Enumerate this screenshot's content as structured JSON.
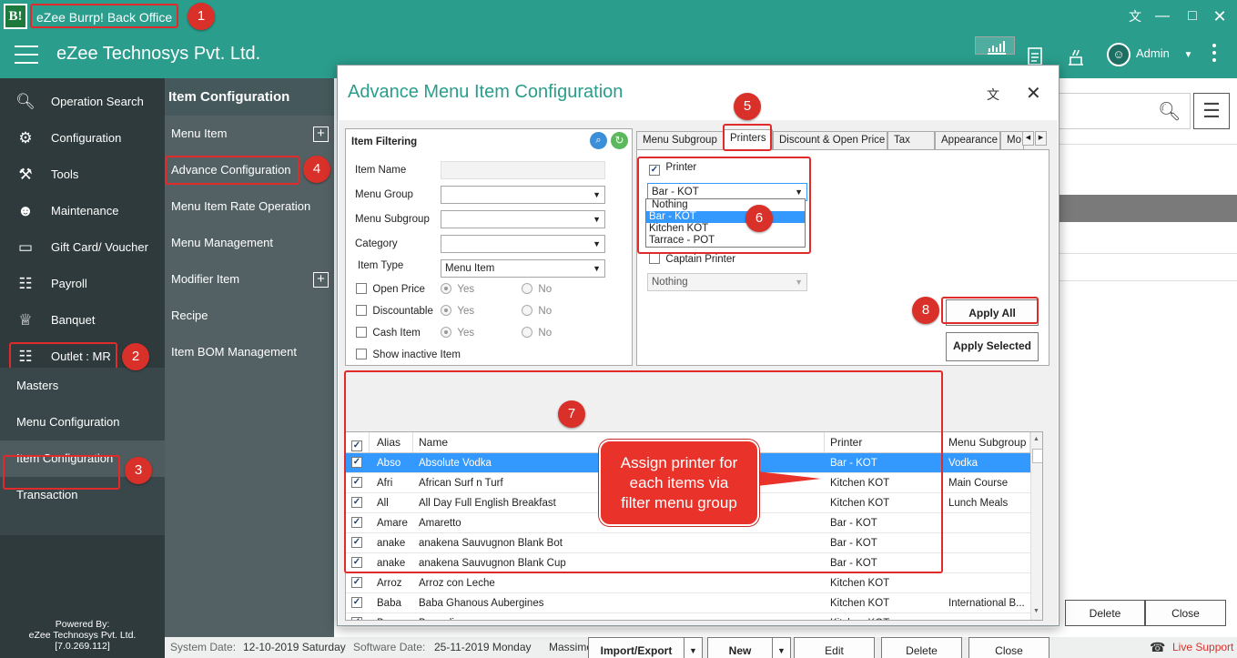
{
  "window": {
    "logo_text": "B!",
    "app_title": "eZee Burrp! Back Office"
  },
  "header": {
    "company": "eZee Technosys Pvt. Ltd.",
    "user": "Admin"
  },
  "sidebar": {
    "items": [
      {
        "label": "Operation Search"
      },
      {
        "label": "Configuration"
      },
      {
        "label": "Tools"
      },
      {
        "label": "Maintenance"
      },
      {
        "label": "Gift Card/ Voucher"
      },
      {
        "label": "Payroll"
      },
      {
        "label": "Banquet"
      },
      {
        "label": "Outlet : MR"
      }
    ],
    "sub_items": [
      {
        "label": "Masters"
      },
      {
        "label": "Menu Configuration"
      },
      {
        "label": "Item Configuration"
      },
      {
        "label": "Transaction"
      }
    ],
    "powered": [
      "Powered By:",
      "eZee Technosys Pvt. Ltd.",
      "[7.0.269.112]"
    ]
  },
  "submenu": {
    "title": "Item Configuration",
    "items": [
      {
        "label": "Menu Item"
      },
      {
        "label": "Advance Configuration"
      },
      {
        "label": "Menu Item Rate Operation"
      },
      {
        "label": "Menu Management"
      },
      {
        "label": "Modifier Item"
      },
      {
        "label": "Recipe"
      },
      {
        "label": "Item BOM Management"
      }
    ]
  },
  "background": {
    "delete_label": "Delete",
    "close_label": "Close"
  },
  "statusbar": {
    "system_date_label": "System Date:",
    "system_date": "12-10-2019 Saturday",
    "software_date_label": "Software Date:",
    "software_date": "25-11-2019 Monday",
    "property": "Massimo Ristorante",
    "support": "Live Support"
  },
  "dialog": {
    "title": "Advance Menu Item Configuration",
    "filter": {
      "heading": "Item Filtering",
      "item_name_label": "Item Name",
      "menu_group_label": "Menu Group",
      "menu_subgroup_label": "Menu Subgroup",
      "category_label": "Category",
      "item_type_label": "Item Type",
      "item_type_value": "Menu Item",
      "open_price_label": "Open Price",
      "discountable_label": "Discountable",
      "cash_item_label": "Cash Item",
      "yes_label": "Yes",
      "no_label": "No",
      "show_inactive_label": "Show inactive Item"
    },
    "tabs": [
      "Menu Subgroup",
      "Printers",
      "Discount & Open Price",
      "Tax",
      "Appearance",
      "Mo"
    ],
    "printers": {
      "printer_label": "Printer",
      "printer_value": "Bar - KOT",
      "options": [
        "Nothing",
        "Bar - KOT",
        "Kitchen KOT",
        "Tarrace - POT"
      ],
      "selected_option": "Bar - KOT",
      "captain_label": "Captain Printer",
      "captain_value": "Nothing",
      "apply_all": "Apply All",
      "apply_selected": "Apply Selected"
    },
    "grid": {
      "columns": [
        "Alias",
        "Name",
        "Printer",
        "Menu Subgroup"
      ],
      "rows": [
        {
          "alias": "Abso",
          "name": "Absolute Vodka",
          "printer": "Bar - KOT",
          "subgroup": "Vodka"
        },
        {
          "alias": "Afri",
          "name": "African Surf n Turf",
          "printer": "Kitchen KOT",
          "subgroup": "Main Course"
        },
        {
          "alias": "All",
          "name": "All Day Full English Breakfast",
          "printer": "Kitchen KOT",
          "subgroup": "Lunch Meals"
        },
        {
          "alias": "Amare",
          "name": "Amaretto",
          "printer": "Bar - KOT",
          "subgroup": ""
        },
        {
          "alias": "anake",
          "name": "anakena Sauvugnon Blank Bot",
          "printer": "Bar - KOT",
          "subgroup": ""
        },
        {
          "alias": "anake",
          "name": "anakena Sauvugnon Blank Cup",
          "printer": "Bar - KOT",
          "subgroup": ""
        },
        {
          "alias": "Arroz",
          "name": "Arroz con Leche",
          "printer": "Kitchen KOT",
          "subgroup": ""
        },
        {
          "alias": "Baba",
          "name": "Baba Ghanous Aubergines",
          "printer": "Kitchen KOT",
          "subgroup": "International B..."
        },
        {
          "alias": "Bacar",
          "name": "Bacardi",
          "printer": "Kitchen KOT",
          "subgroup": ""
        }
      ]
    },
    "buttons": {
      "import_export": "Import/Export",
      "new": "New",
      "edit": "Edit",
      "delete": "Delete",
      "close": "Close"
    }
  },
  "annotations": {
    "badges": [
      "1",
      "2",
      "3",
      "4",
      "5",
      "6",
      "7",
      "8"
    ],
    "callout_lines": [
      "Assign printer for",
      "each items via",
      "filter menu group"
    ]
  },
  "colors": {
    "primary": "#2a9d8c",
    "sidebar": "#2e3a3c",
    "annotation": "#d9302a",
    "selection": "#3399ff"
  }
}
